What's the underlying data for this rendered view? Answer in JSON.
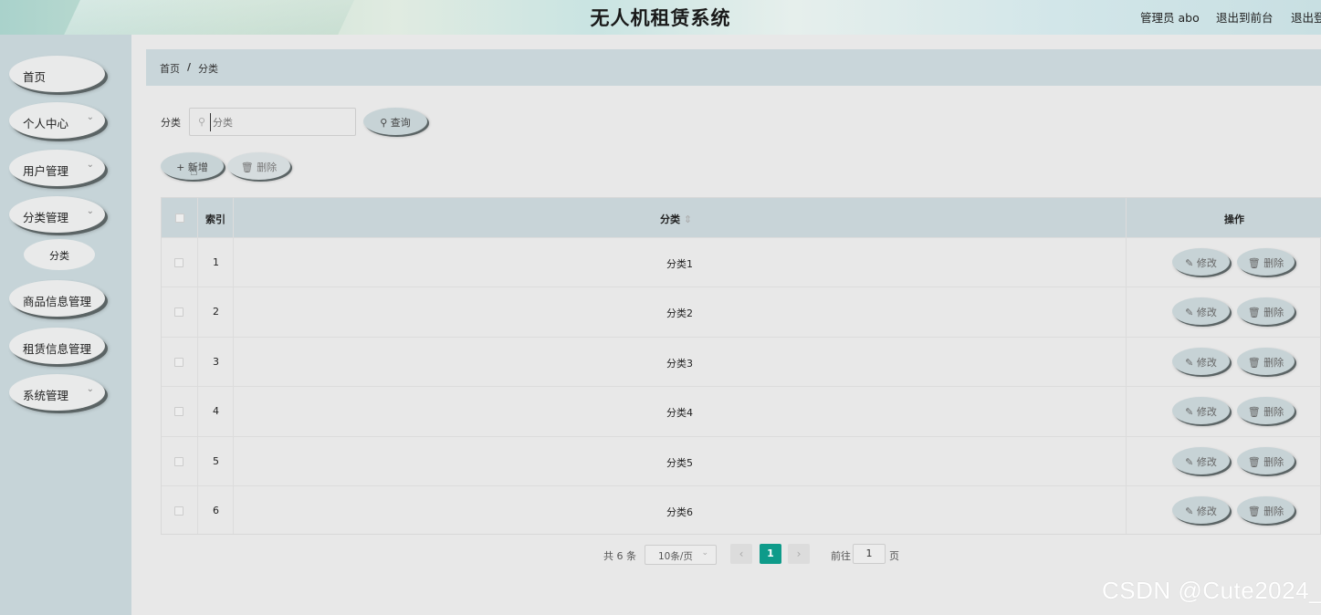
{
  "header": {
    "title": "无人机租赁系统",
    "user": "管理员 abo",
    "exit_front": "退出到前台",
    "exit_login": "退出登"
  },
  "sidebar": {
    "items": [
      {
        "label": "首页"
      },
      {
        "label": "个人中心"
      },
      {
        "label": "用户管理"
      },
      {
        "label": "分类管理"
      },
      {
        "label": "分类"
      },
      {
        "label": "商品信息管理"
      },
      {
        "label": "租赁信息管理"
      },
      {
        "label": "系统管理"
      }
    ]
  },
  "breadcrumb": {
    "home": "首页",
    "sep": "/",
    "current": "分类"
  },
  "search": {
    "label": "分类",
    "placeholder": "分类",
    "query_button": "查询"
  },
  "toolbar": {
    "add_label": "新增",
    "delete_label": "删除"
  },
  "table": {
    "headers": {
      "index": "索引",
      "category": "分类",
      "actions": "操作"
    },
    "rows": [
      {
        "index": "1",
        "category": "分类1"
      },
      {
        "index": "2",
        "category": "分类2"
      },
      {
        "index": "3",
        "category": "分类3"
      },
      {
        "index": "4",
        "category": "分类4"
      },
      {
        "index": "5",
        "category": "分类5"
      },
      {
        "index": "6",
        "category": "分类6"
      }
    ],
    "edit_label": "修改",
    "delete_label": "删除"
  },
  "pagination": {
    "total": "共 6 条",
    "page_size": "10条/页",
    "current_page": "1",
    "goto_label": "前往",
    "goto_value": "1",
    "page_suffix": "页"
  },
  "watermark": "CSDN @Cute2024_",
  "colors": {
    "accent": "#0e9b8a",
    "sidebar": "#c6d4d8",
    "table_header": "#c8d4d8"
  }
}
